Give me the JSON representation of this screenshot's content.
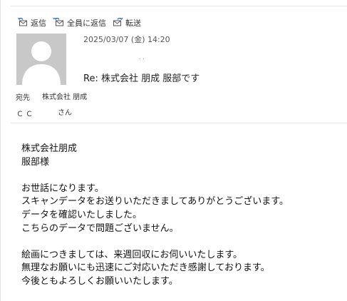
{
  "toolbar": {
    "reply_label": "返信",
    "reply_all_label": "全員に返信",
    "forward_label": "転送"
  },
  "message": {
    "date": "2025/03/07 (金) 14:20",
    "subject": "Re: 株式会社 朋成 服部です",
    "to_label": "宛先",
    "to_value": "株式会社 朋成",
    "cc_label": "ＣＣ",
    "to_suffix": "さん"
  },
  "body": {
    "greeting_line1": "株式会社朋成",
    "greeting_line2": "服部様",
    "para1_line1": "お世話になります。",
    "para1_line2": "スキャンデータをお送りいただきましてありがとうございます。",
    "para1_line3": "データを確認いたしました。",
    "para1_line4": "こちらのデータで問題ございません。",
    "para2_line1": "絵画につきましては、来週回収にお伺いいたします。",
    "para2_line2": "無理なお願いにも迅速にご対応いただき感謝しております。",
    "para2_line3": "今後ともよろしくお願いいたします。"
  },
  "icons": {
    "reply": "reply-icon",
    "reply_all": "reply-all-icon",
    "forward": "forward-icon",
    "avatar": "person-silhouette-icon"
  },
  "colors": {
    "avatar_bg": "#c8c8c8",
    "icon_blue": "#3b6fb6"
  }
}
